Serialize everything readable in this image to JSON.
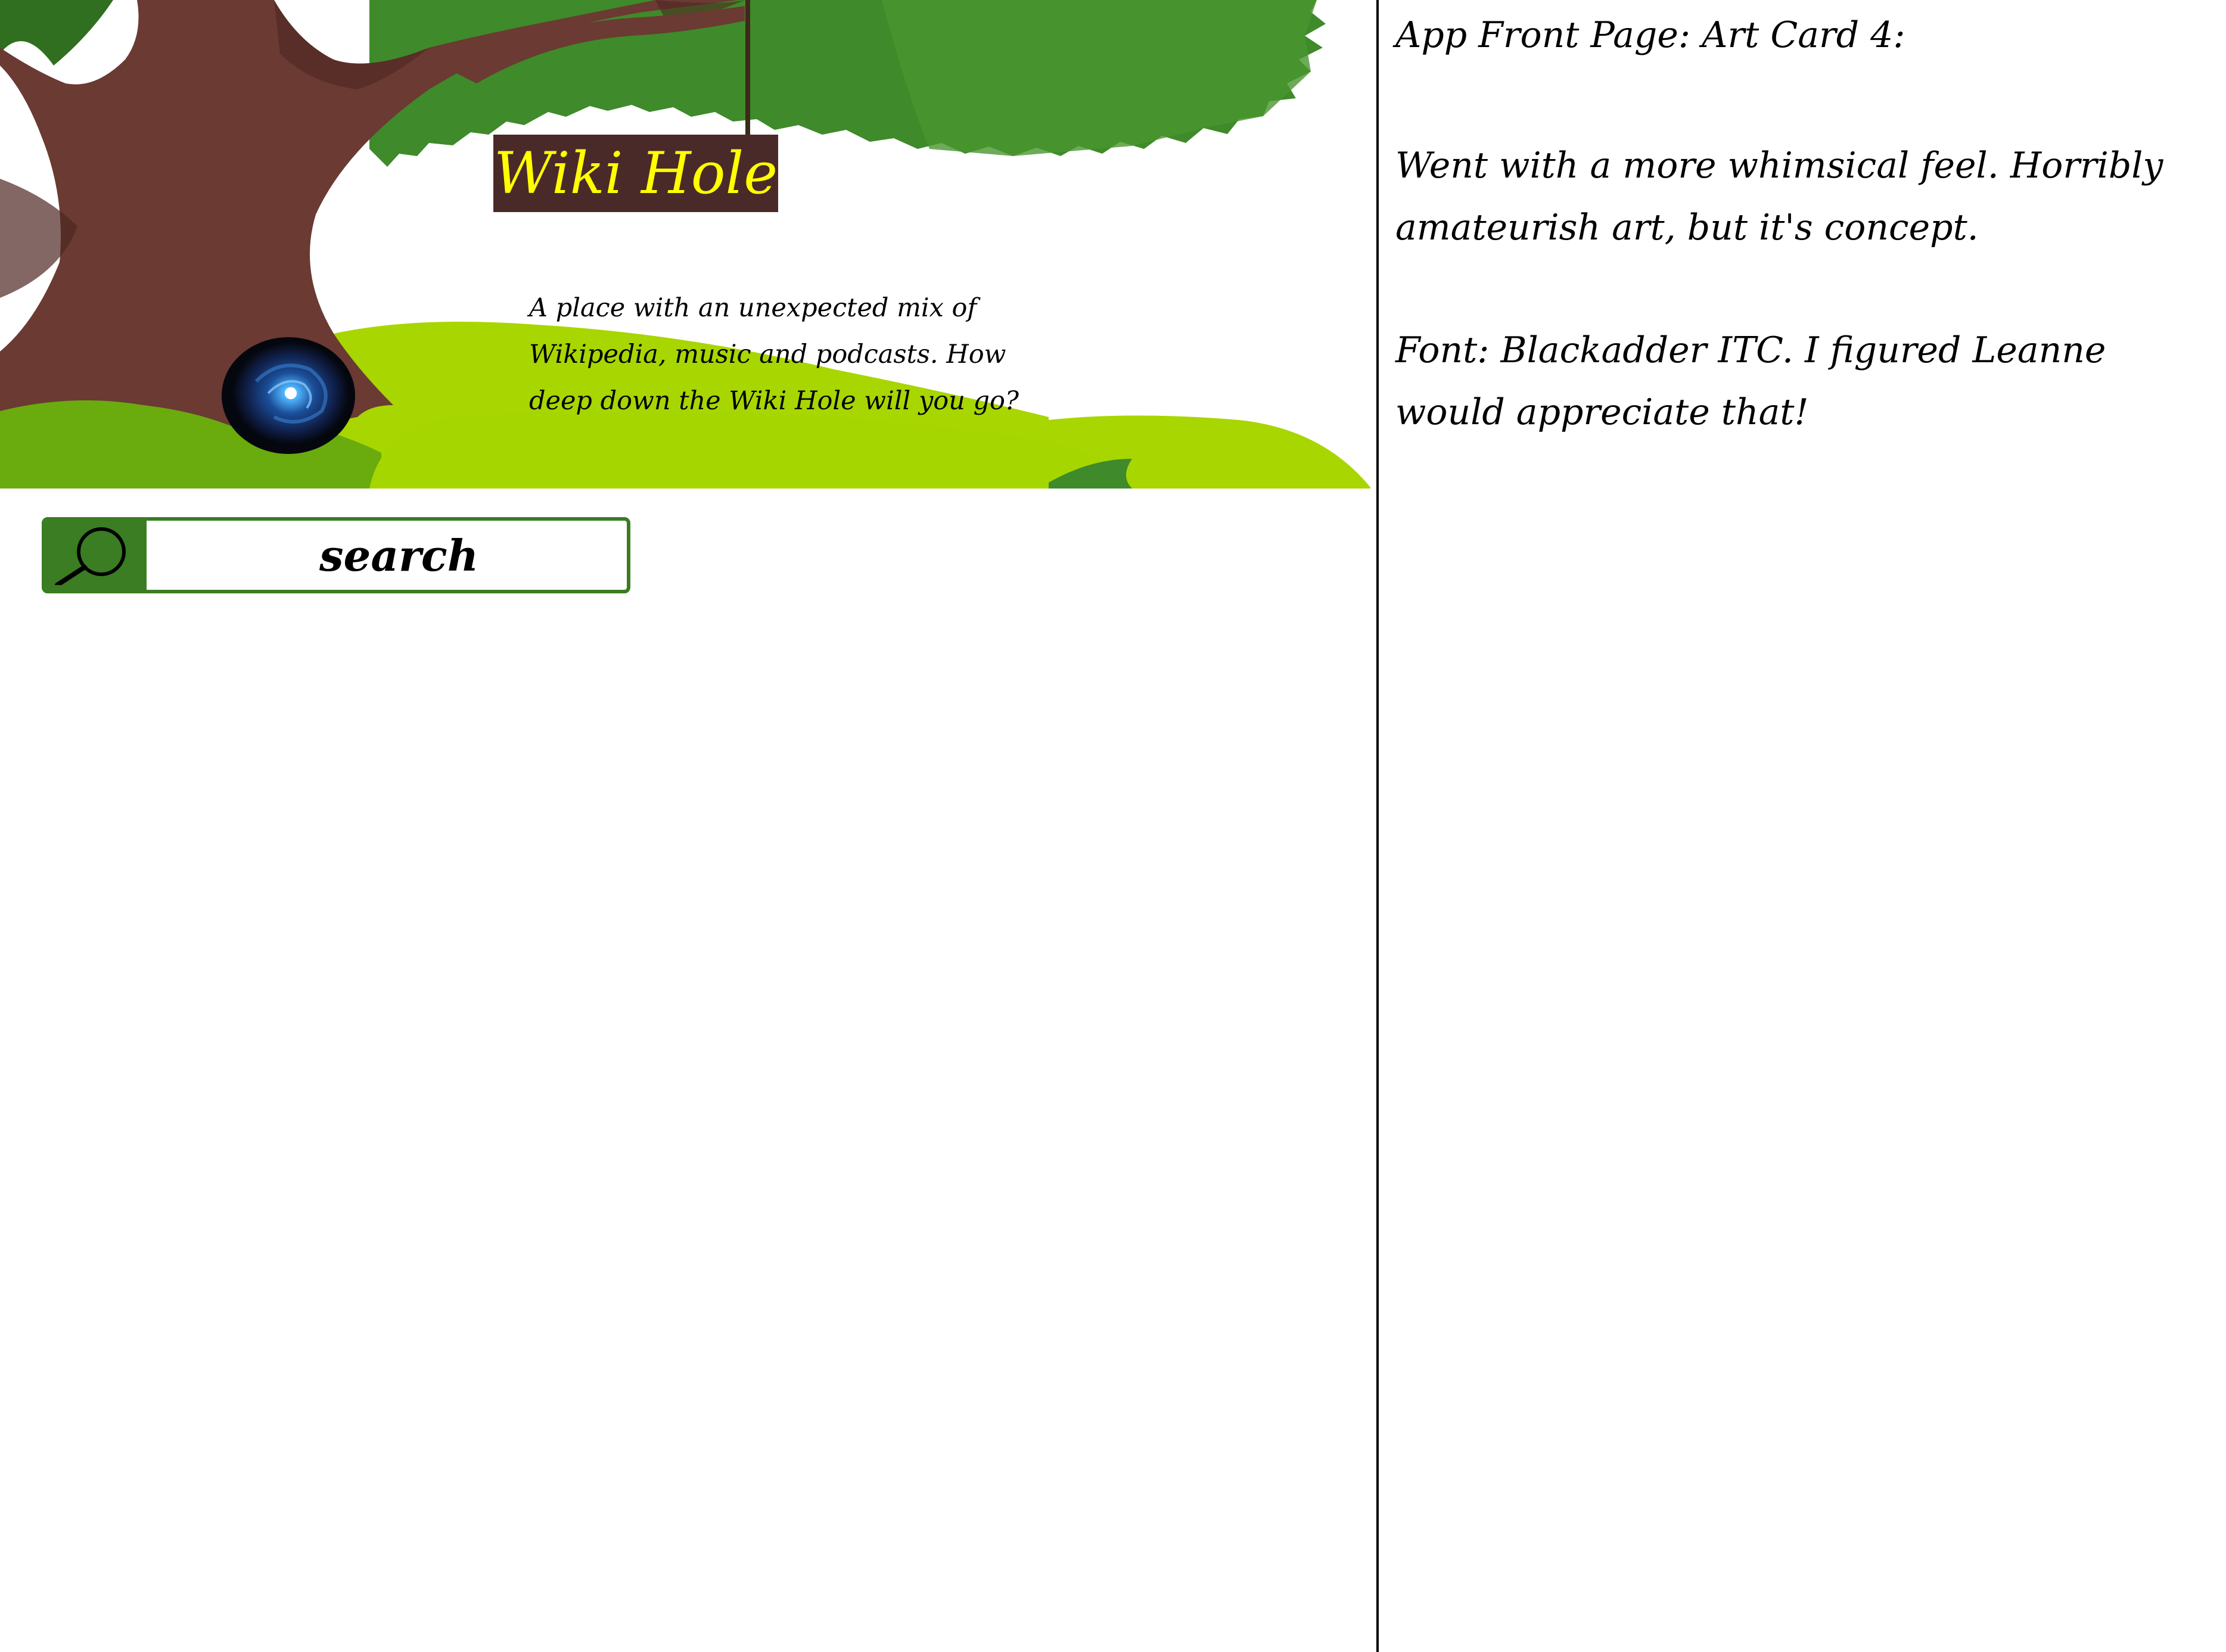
{
  "app": {
    "title": "Wiki Hole",
    "tagline": "A place with an unexpected mix of Wikipedia, music and podcasts. How deep down the Wiki Hole will you go?",
    "search": {
      "placeholder": "search",
      "icon": "magnifier-icon"
    },
    "colors": {
      "sign_background": "#4a2a28",
      "sign_text": "#ffff00",
      "search_accent": "#3a7d22",
      "foliage": "#3f8a2a",
      "grass_light": "#a8d600",
      "trunk": "#6a3a33"
    }
  },
  "notes": {
    "heading": "App Front Page: Art Card 4:",
    "paragraph_1": "Went with a more whimsical feel. Horribly amateurish art, but it's concept.",
    "paragraph_2": "Font: Blackadder ITC. I figured Leanne would appreciate that!"
  }
}
